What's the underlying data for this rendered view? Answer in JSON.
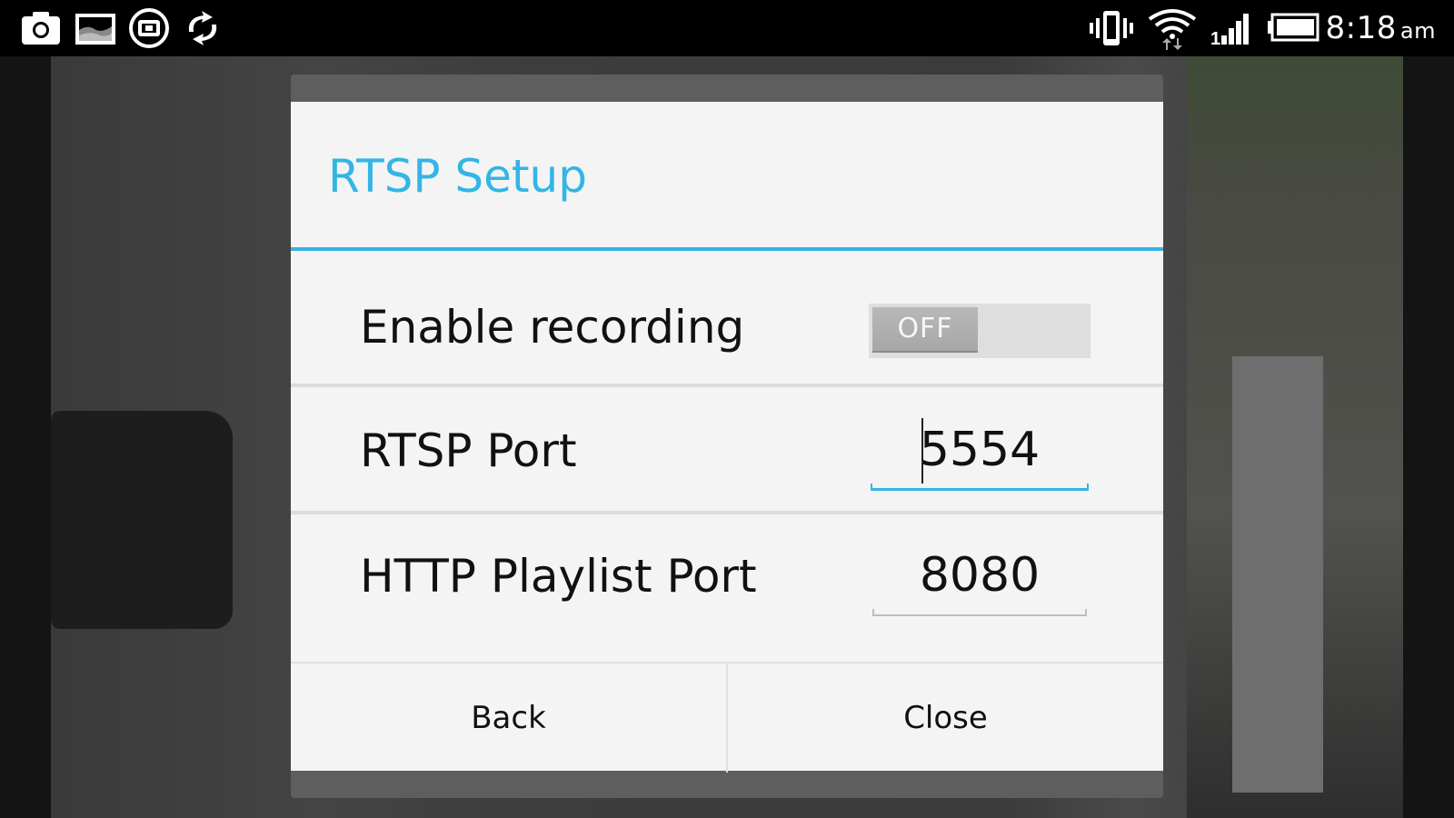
{
  "status_bar": {
    "time": "8:18",
    "ampm": "am",
    "left_icons": [
      "camera-icon",
      "gallery-icon",
      "screenshot-icon",
      "sync-icon"
    ],
    "right_icons": [
      "vibrate-icon",
      "wifi-icon",
      "signal-icon",
      "battery-icon"
    ]
  },
  "dialog": {
    "title": "RTSP Setup",
    "accent_color": "#33b5e5",
    "rows": {
      "recording": {
        "label": "Enable recording",
        "toggle_state": "OFF"
      },
      "rtsp_port": {
        "label": "RTSP Port",
        "value": "5554",
        "focused": true
      },
      "http_port": {
        "label": "HTTP Playlist Port",
        "value": "8080",
        "focused": false
      }
    },
    "buttons": {
      "back": "Back",
      "close": "Close"
    }
  }
}
